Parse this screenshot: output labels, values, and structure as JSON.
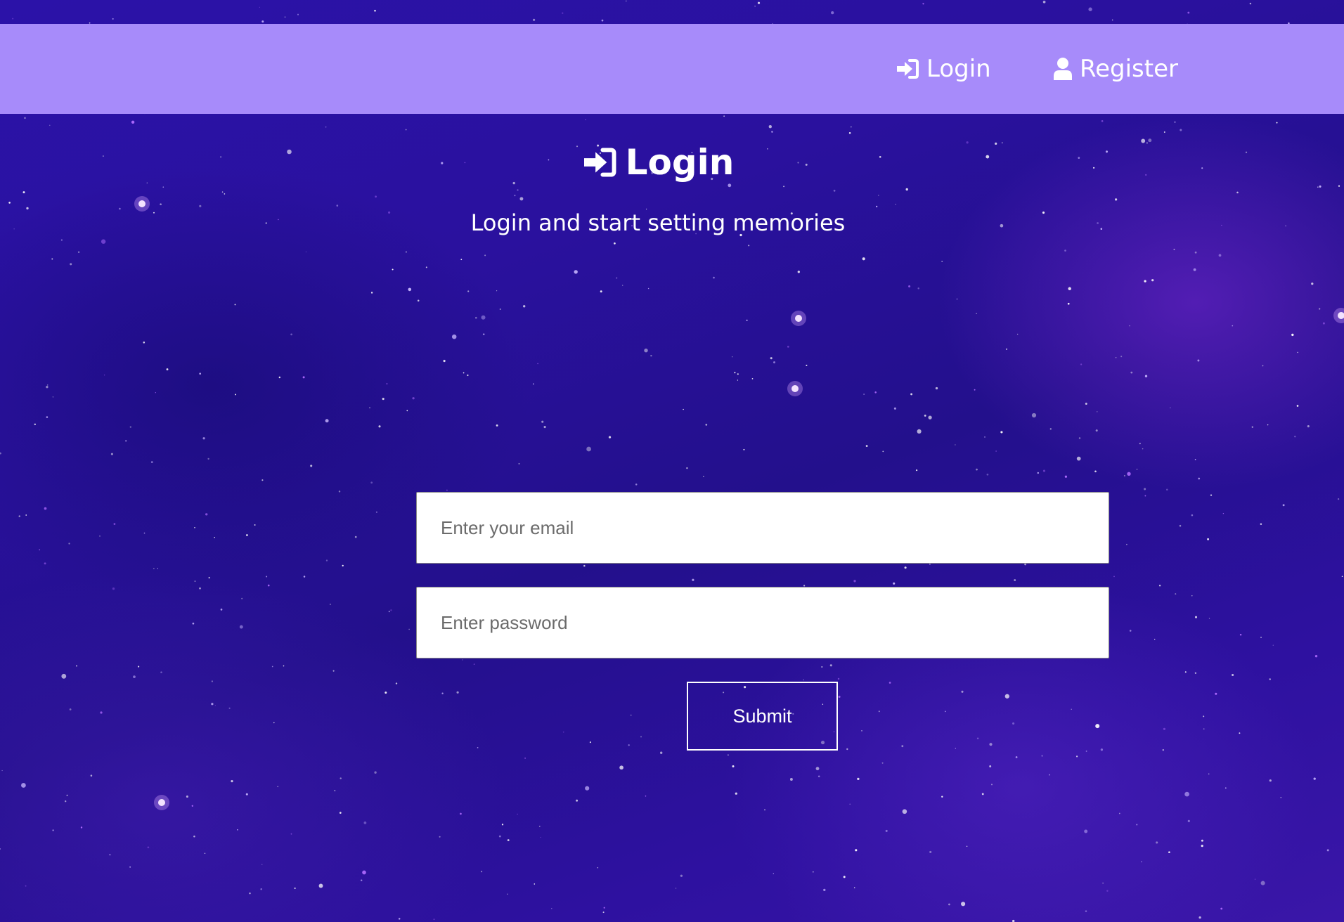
{
  "nav": {
    "login_label": "Login",
    "login_icon": "sign-in-icon",
    "register_label": "Register",
    "register_icon": "user-icon",
    "background_color": "#a78bfa"
  },
  "main": {
    "title": "Login",
    "title_icon": "sign-in-icon",
    "subtitle": "Login and start setting memories"
  },
  "form": {
    "email_placeholder": "Enter your email",
    "email_value": "",
    "password_placeholder": "Enter password",
    "password_value": "",
    "submit_label": "Submit"
  },
  "theme": {
    "background": "starry galaxy",
    "primary_bg": "#2a119e",
    "text_color": "#ffffff"
  }
}
